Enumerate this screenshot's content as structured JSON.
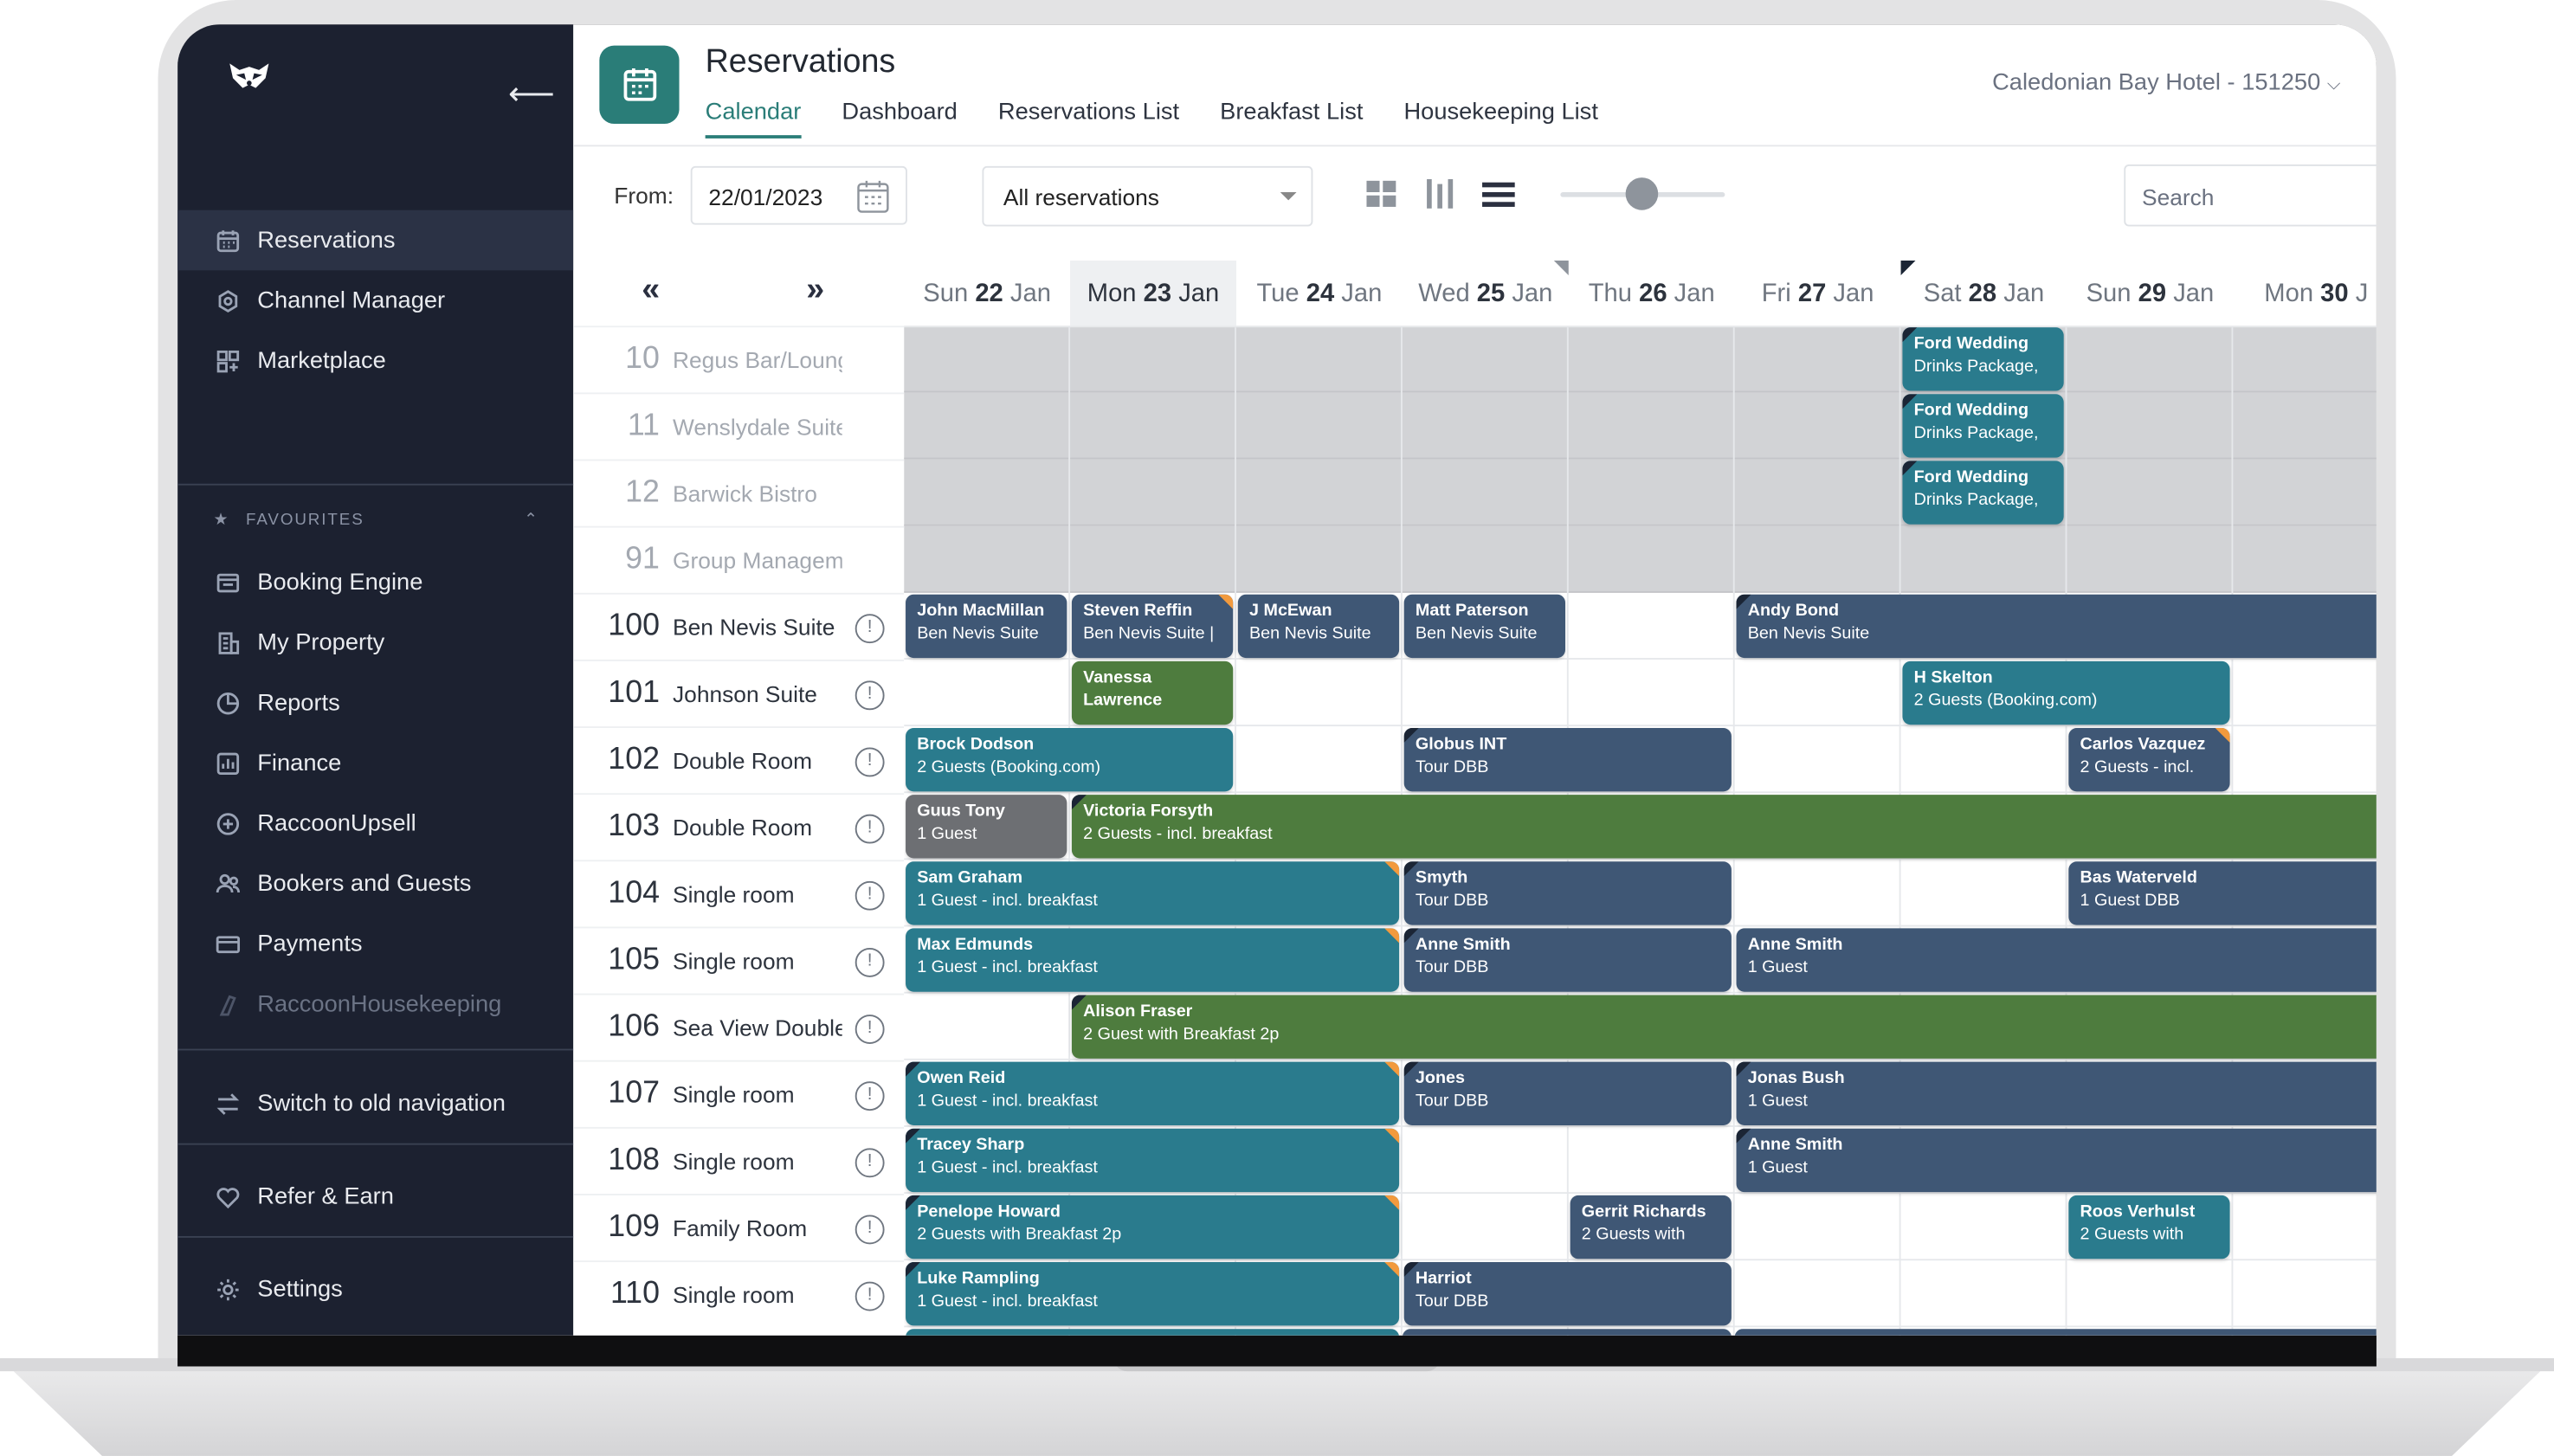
{
  "sidebar": {
    "items": [
      {
        "label": "Reservations",
        "icon": "calendar-icon"
      },
      {
        "label": "Channel Manager",
        "icon": "channel-manager-icon"
      },
      {
        "label": "Marketplace",
        "icon": "marketplace-icon"
      }
    ],
    "favourites_label": "FAVOURITES",
    "favourites": [
      {
        "label": "Booking Engine",
        "icon": "booking-engine-icon"
      },
      {
        "label": "My Property",
        "icon": "property-icon"
      },
      {
        "label": "Reports",
        "icon": "reports-icon"
      },
      {
        "label": "Finance",
        "icon": "finance-icon"
      },
      {
        "label": "RaccoonUpsell",
        "icon": "plus-circle-icon"
      },
      {
        "label": "Bookers and Guests",
        "icon": "users-icon"
      },
      {
        "label": "Payments",
        "icon": "payments-icon"
      },
      {
        "label": "RaccoonHousekeeping",
        "icon": "housekeeping-icon"
      }
    ],
    "switch_label": "Switch to old navigation",
    "refer_label": "Refer & Earn",
    "settings_label": "Settings"
  },
  "header": {
    "title": "Reservations",
    "tabs": [
      "Calendar",
      "Dashboard",
      "Reservations List",
      "Breakfast List",
      "Housekeeping List"
    ],
    "active_tab": "Calendar",
    "hotel": "Caledonian Bay Hotel - 151250"
  },
  "toolbar": {
    "from_label": "From:",
    "from_date": "22/01/2023",
    "filter_value": "All reservations",
    "search_placeholder": "Search"
  },
  "calendar": {
    "prev_label": "«",
    "next_label": "»",
    "days": [
      {
        "pre": "Sun",
        "num": "22",
        "post": "Jan"
      },
      {
        "pre": "Mon",
        "num": "23",
        "post": "Jan",
        "today": true
      },
      {
        "pre": "Tue",
        "num": "24",
        "post": "Jan"
      },
      {
        "pre": "Wed",
        "num": "25",
        "post": "Jan"
      },
      {
        "pre": "Thu",
        "num": "26",
        "post": "Jan"
      },
      {
        "pre": "Fri",
        "num": "27",
        "post": "Jan"
      },
      {
        "pre": "Sat",
        "num": "28",
        "post": "Jan"
      },
      {
        "pre": "Sun",
        "num": "29",
        "post": "Jan"
      },
      {
        "pre": "Mon",
        "num": "30",
        "post": "J"
      }
    ],
    "rooms": [
      {
        "num": "10",
        "name": "Regus Bar/Lounge",
        "closed": true
      },
      {
        "num": "11",
        "name": "Wenslydale Suite",
        "closed": true
      },
      {
        "num": "12",
        "name": "Barwick Bistro",
        "closed": true
      },
      {
        "num": "91",
        "name": "Group Manageme...",
        "closed": true
      },
      {
        "num": "100",
        "name": "Ben Nevis Suite"
      },
      {
        "num": "101",
        "name": "Johnson Suite"
      },
      {
        "num": "102",
        "name": "Double Room"
      },
      {
        "num": "103",
        "name": "Double Room"
      },
      {
        "num": "104",
        "name": "Single room"
      },
      {
        "num": "105",
        "name": "Single room"
      },
      {
        "num": "106",
        "name": "Sea View Double"
      },
      {
        "num": "107",
        "name": "Single room"
      },
      {
        "num": "108",
        "name": "Single room"
      },
      {
        "num": "109",
        "name": "Family Room"
      },
      {
        "num": "110",
        "name": "Single room"
      }
    ],
    "bookings": [
      {
        "row": 0,
        "start": 6,
        "span": 1,
        "name": "Ford Wedding",
        "detail": "Drinks Package,",
        "color": "teal",
        "tl": true
      },
      {
        "row": 1,
        "start": 6,
        "span": 1,
        "name": "Ford Wedding",
        "detail": "Drinks Package,",
        "color": "teal",
        "tl": true
      },
      {
        "row": 2,
        "start": 6,
        "span": 1,
        "name": "Ford Wedding",
        "detail": "Drinks Package,",
        "color": "teal",
        "tl": true
      },
      {
        "row": 4,
        "start": 0,
        "span": 1,
        "name": "John MacMillan",
        "detail": "Ben Nevis Suite",
        "color": "navy"
      },
      {
        "row": 4,
        "start": 1,
        "span": 1,
        "name": "Steven Reffin",
        "detail": "Ben Nevis Suite |",
        "color": "navy",
        "tr": true
      },
      {
        "row": 4,
        "start": 2,
        "span": 1,
        "name": "J McEwan",
        "detail": "Ben Nevis Suite",
        "color": "navy"
      },
      {
        "row": 4,
        "start": 3,
        "span": 1,
        "name": "Matt Paterson",
        "detail": "Ben Nevis Suite",
        "color": "navy"
      },
      {
        "row": 4,
        "start": 5,
        "span": 4,
        "name": "Andy Bond",
        "detail": "Ben Nevis Suite",
        "color": "navy",
        "tl": true,
        "open": true
      },
      {
        "row": 5,
        "start": 1,
        "span": 1,
        "name": "Vanessa",
        "detail": "Lawrence",
        "color": "green",
        "bold2": true
      },
      {
        "row": 5,
        "start": 6,
        "span": 2,
        "name": "H Skelton",
        "detail": "2 Guests (Booking.com)",
        "color": "teal"
      },
      {
        "row": 6,
        "start": 0,
        "span": 2,
        "name": "Brock Dodson",
        "detail": "2 Guests (Booking.com)",
        "color": "teal"
      },
      {
        "row": 6,
        "start": 3,
        "span": 2,
        "name": "Globus INT",
        "detail": "Tour DBB",
        "color": "navy",
        "tl": true
      },
      {
        "row": 6,
        "start": 7,
        "span": 1,
        "name": "Carlos Vazquez",
        "detail": "2 Guests - incl.",
        "color": "navy",
        "tr": true
      },
      {
        "row": 7,
        "start": 0,
        "span": 1,
        "name": "Guus Tony",
        "detail": "1 Guest",
        "color": "grey"
      },
      {
        "row": 7,
        "start": 1,
        "span": 8,
        "name": "Victoria Forsyth",
        "detail": "2 Guests - incl. breakfast",
        "color": "green",
        "tl": true,
        "open": true
      },
      {
        "row": 8,
        "start": 0,
        "span": 3,
        "name": "Sam Graham",
        "detail": "1 Guest - incl. breakfast",
        "color": "teal",
        "tr": true
      },
      {
        "row": 8,
        "start": 3,
        "span": 2,
        "name": "Smyth",
        "detail": "Tour DBB",
        "color": "navy",
        "tl": true
      },
      {
        "row": 8,
        "start": 7,
        "span": 2,
        "name": "Bas Waterveld",
        "detail": "1 Guest DBB",
        "color": "navy",
        "open": true
      },
      {
        "row": 9,
        "start": 0,
        "span": 3,
        "name": "Max Edmunds",
        "detail": "1 Guest - incl. breakfast",
        "color": "teal",
        "tr": true
      },
      {
        "row": 9,
        "start": 3,
        "span": 2,
        "name": "Anne Smith",
        "detail": "Tour DBB",
        "color": "navy",
        "tl": true
      },
      {
        "row": 9,
        "start": 5,
        "span": 4,
        "name": "Anne Smith",
        "detail": "1 Guest",
        "color": "navy",
        "open": true
      },
      {
        "row": 10,
        "start": 1,
        "span": 8,
        "name": "Alison Fraser",
        "detail": "2 Guest with Breakfast 2p",
        "color": "green",
        "tl": true,
        "open": true
      },
      {
        "row": 11,
        "start": 0,
        "span": 3,
        "name": "Owen Reid",
        "detail": "1 Guest - incl. breakfast",
        "color": "teal",
        "tl": true,
        "tr": true
      },
      {
        "row": 11,
        "start": 3,
        "span": 2,
        "name": "Jones",
        "detail": "Tour DBB",
        "color": "navy",
        "tl": true
      },
      {
        "row": 11,
        "start": 5,
        "span": 4,
        "name": "Jonas Bush",
        "detail": "1 Guest",
        "color": "navy",
        "tl": true,
        "open": true
      },
      {
        "row": 12,
        "start": 0,
        "span": 3,
        "name": "Tracey Sharp",
        "detail": "1 Guest - incl. breakfast",
        "color": "teal",
        "tl": true,
        "tr": true
      },
      {
        "row": 12,
        "start": 5,
        "span": 4,
        "name": "Anne Smith",
        "detail": "1 Guest",
        "color": "navy",
        "tl": true,
        "open": true
      },
      {
        "row": 13,
        "start": 0,
        "span": 3,
        "name": "Penelope Howard",
        "detail": "2 Guests with Breakfast 2p",
        "color": "teal",
        "tl": true,
        "tr": true
      },
      {
        "row": 13,
        "start": 4,
        "span": 1,
        "name": "Gerrit Richards",
        "detail": "2 Guests with",
        "color": "navy"
      },
      {
        "row": 13,
        "start": 7,
        "span": 1,
        "name": "Roos Verhulst",
        "detail": "2 Guests with",
        "color": "teal"
      },
      {
        "row": 14,
        "start": 0,
        "span": 3,
        "name": "Luke Rampling",
        "detail": "1 Guest - incl. breakfast",
        "color": "teal",
        "tl": true,
        "tr": true
      },
      {
        "row": 14,
        "start": 3,
        "span": 2,
        "name": "Harriot",
        "detail": "Tour DBB",
        "color": "navy",
        "tl": true
      }
    ]
  },
  "colors": {
    "accent": "#2a7d78",
    "sidebar": "#1c2130",
    "teal": "#2a7b8d",
    "navy": "#3f5775",
    "green": "#4e7c3e",
    "grey": "#6d6f73",
    "flag_orange": "#f29a3d"
  }
}
